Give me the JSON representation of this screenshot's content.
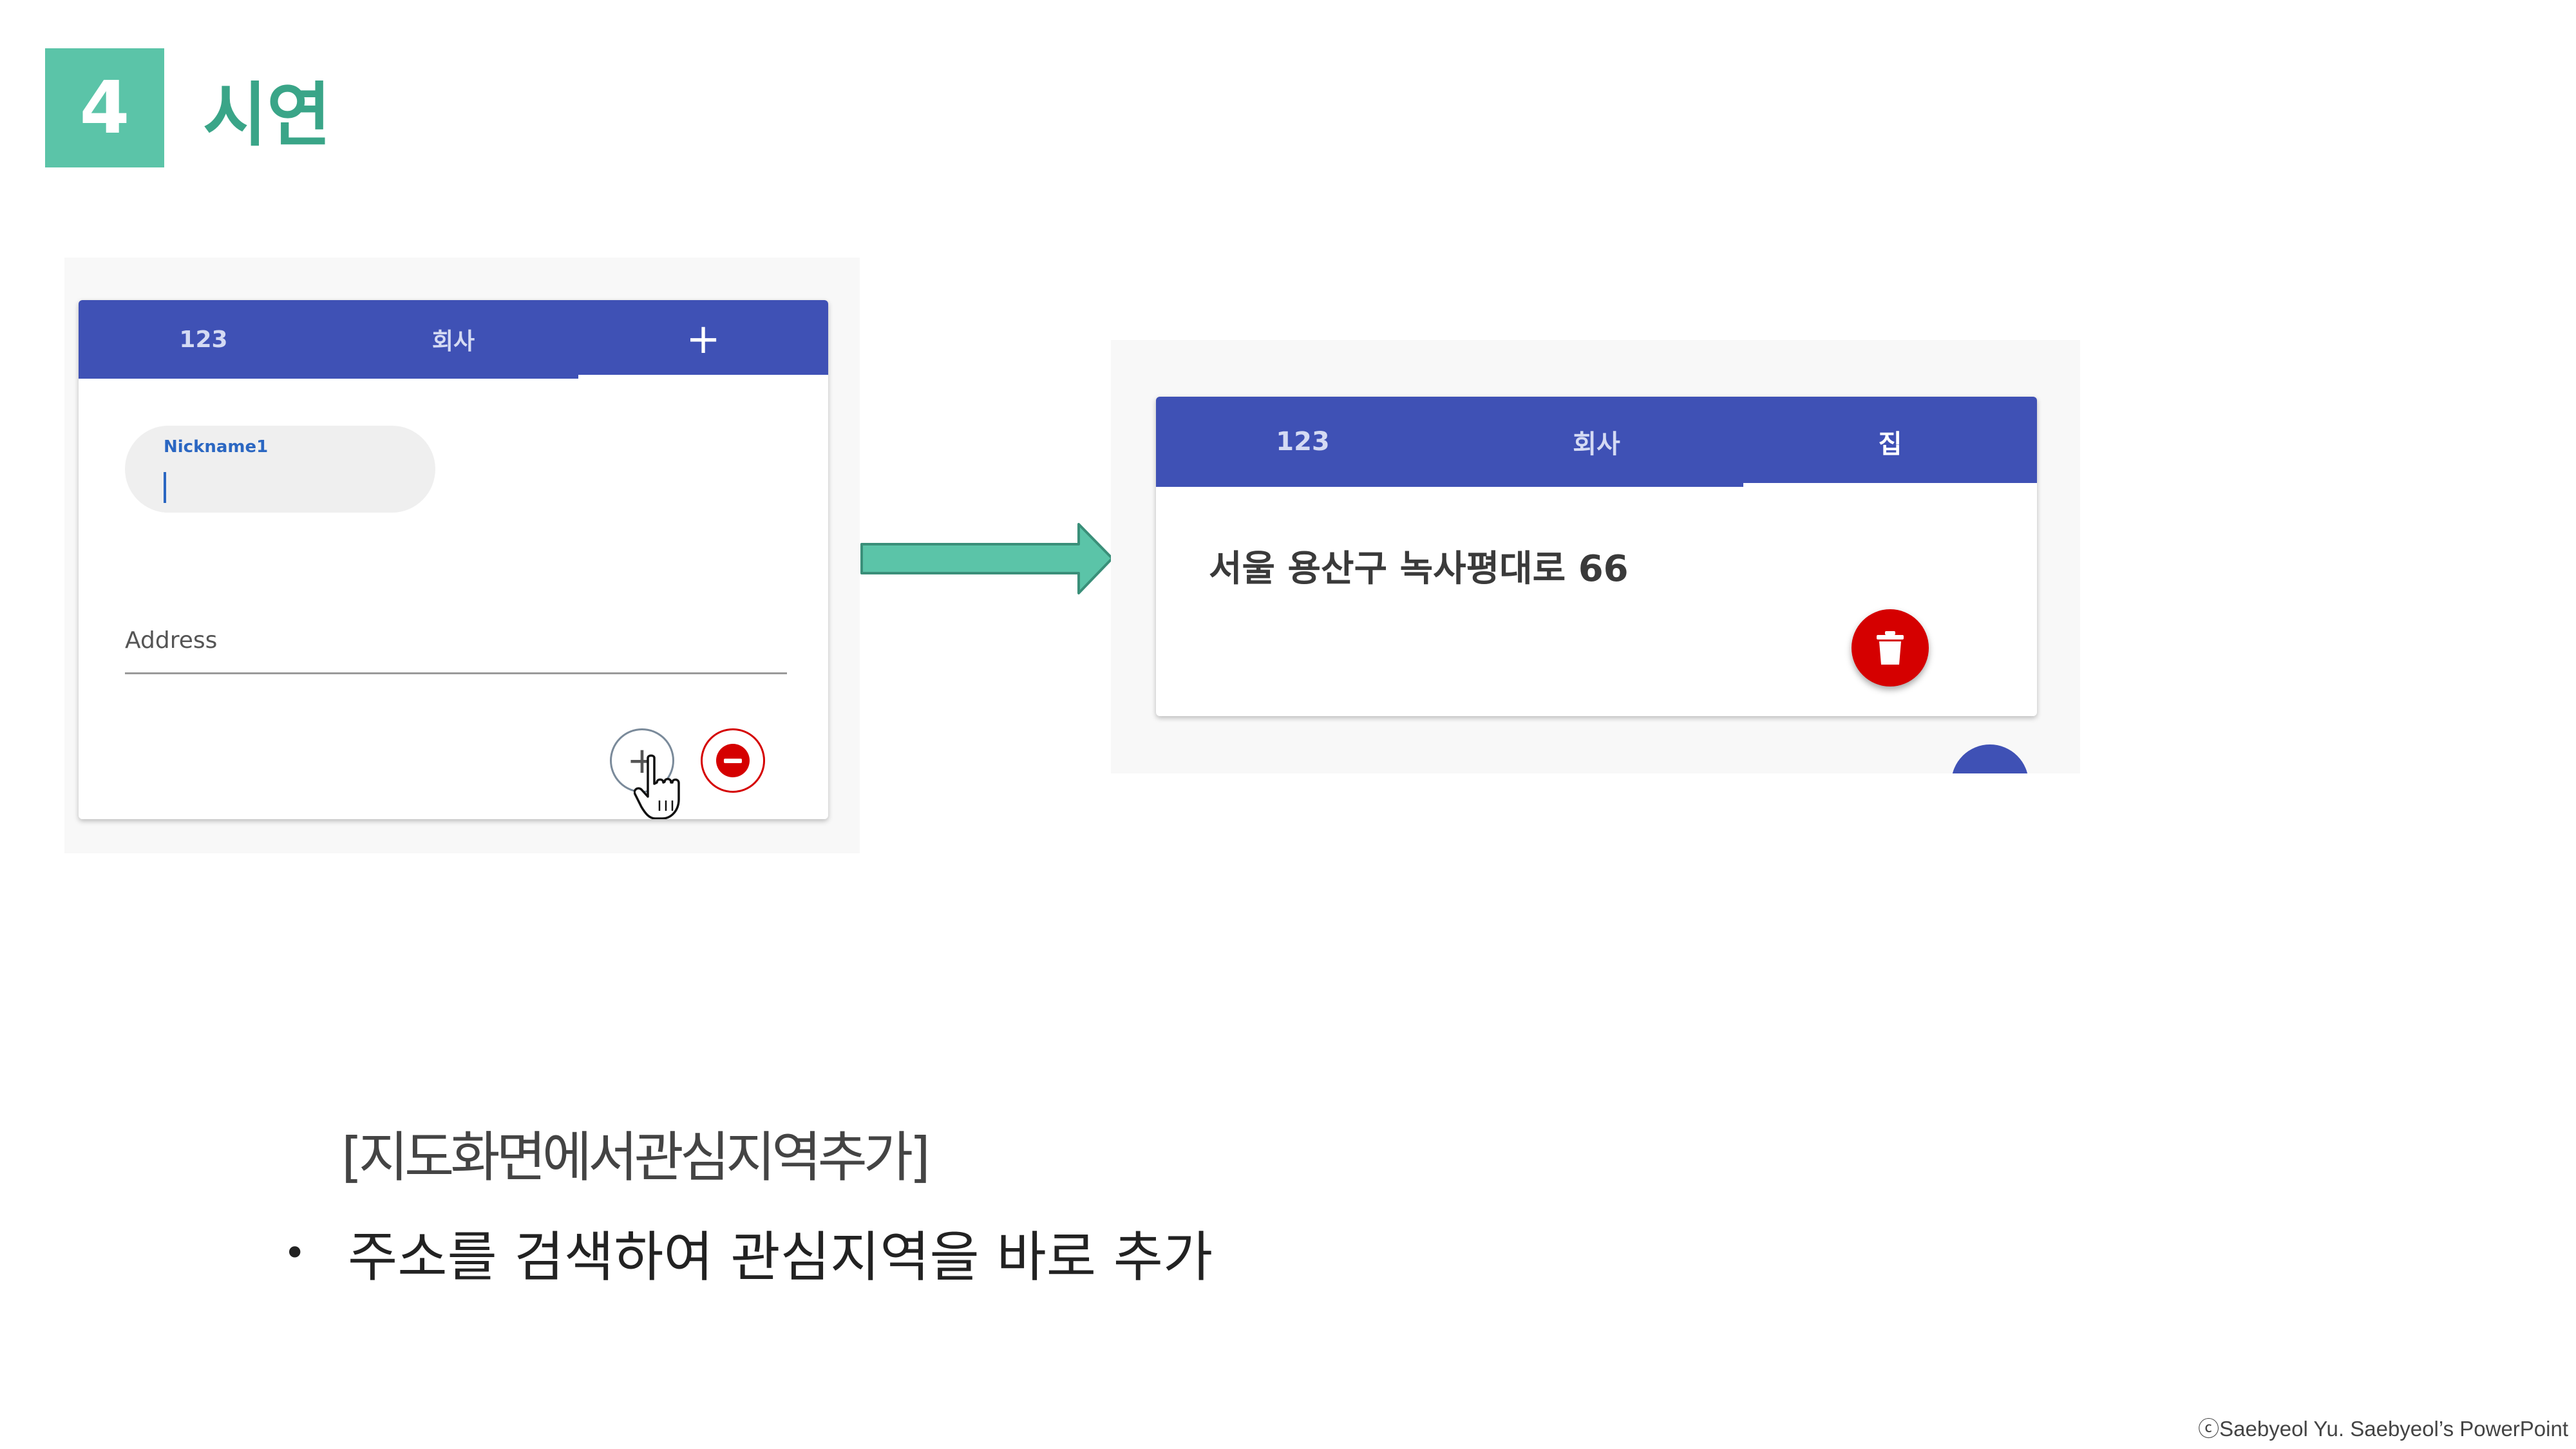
{
  "slide": {
    "number": "4",
    "title": "시연"
  },
  "left_screenshot": {
    "tabs": [
      {
        "label": "123",
        "active": false
      },
      {
        "label": "회사",
        "active": false
      },
      {
        "label": "+",
        "active": true
      }
    ],
    "nickname_field_label": "Nickname1",
    "nickname_value": "",
    "address_label": "Address",
    "address_value": "",
    "add_icon": "plus-icon",
    "remove_icon": "minus-circle-icon",
    "cursor_icon": "hand-pointer-icon"
  },
  "arrow_icon": "right-arrow-icon",
  "right_screenshot": {
    "tabs": [
      {
        "label": "123",
        "active": false
      },
      {
        "label": "회사",
        "active": false
      },
      {
        "label": "집",
        "active": true
      }
    ],
    "address": "서울 용산구 녹사평대로 66",
    "delete_icon": "trash-icon"
  },
  "caption": "[지도화면에서관심지역추가]",
  "bullets": [
    "주소를 검색하여 관심지역을 바로 추가"
  ],
  "credit": "ⓒSaebyeol Yu. Saebyeol’s PowerPoint",
  "colors": {
    "accent_green": "#5bc4a8",
    "title_green": "#3aa588",
    "app_bar_blue": "#3f51b5",
    "danger_red": "#d50000"
  }
}
